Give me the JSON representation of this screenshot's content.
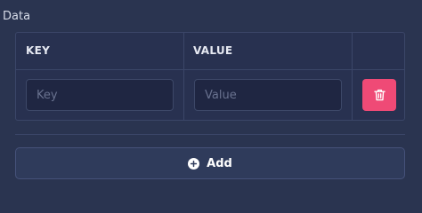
{
  "section": {
    "label": "Data"
  },
  "table": {
    "columns": {
      "key": "KEY",
      "value": "VALUE"
    },
    "row": {
      "key_placeholder": "Key",
      "key_value": "",
      "value_placeholder": "Value",
      "value_value": "",
      "delete_icon": "trash-icon"
    }
  },
  "add_button": {
    "label": "Add",
    "icon": "plus-circle-icon"
  },
  "colors": {
    "background": "#2a3450",
    "delete_button": "#ef4a76",
    "input_background": "#1f2642",
    "border": "#3b4668"
  }
}
